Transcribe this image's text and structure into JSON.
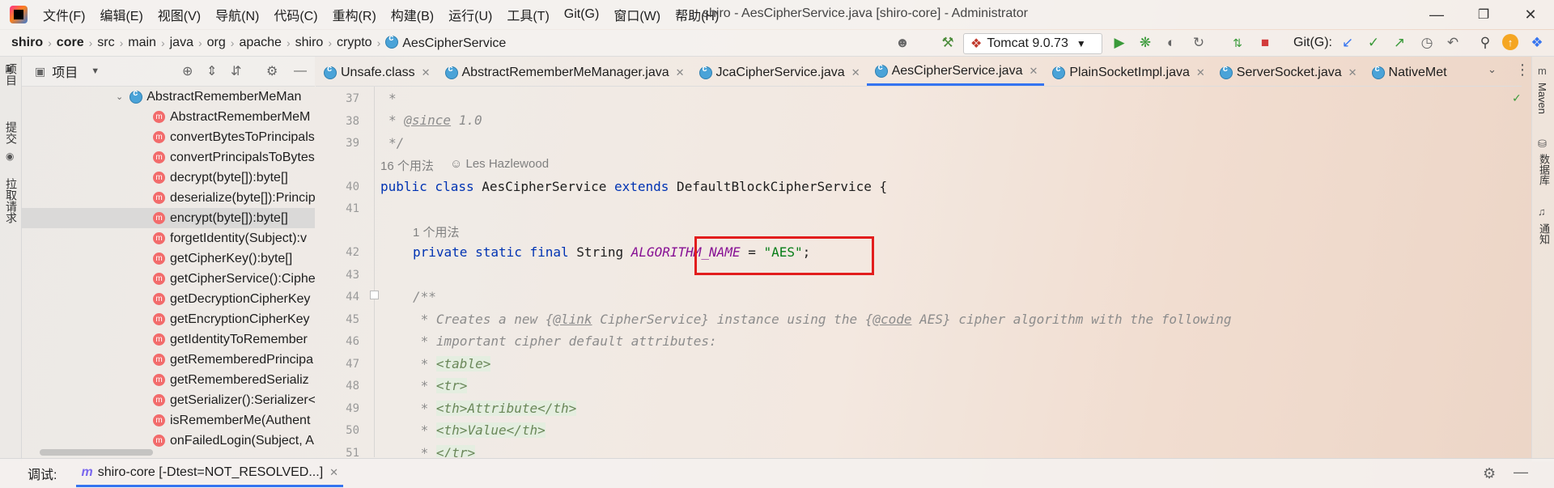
{
  "menubar": {
    "items": [
      "文件(F)",
      "编辑(E)",
      "视图(V)",
      "导航(N)",
      "代码(C)",
      "重构(R)",
      "构建(B)",
      "运行(U)",
      "工具(T)",
      "Git(G)",
      "窗口(W)",
      "帮助(H)"
    ],
    "window_title": "shiro - AesCipherService.java [shiro-core] - Administrator"
  },
  "breadcrumb": [
    "shiro",
    "core",
    "src",
    "main",
    "java",
    "org",
    "apache",
    "shiro",
    "crypto",
    "AesCipherService"
  ],
  "toolbar": {
    "run_config": "Tomcat 9.0.73",
    "git_label": "Git(G):"
  },
  "left_strip": {
    "project": "项目",
    "commit": "提交",
    "pull_requests": "拉取请求"
  },
  "project_panel": {
    "title": "项目",
    "tree": [
      {
        "label": "AbstractRememberMeMan",
        "kind": "class"
      },
      {
        "label": "AbstractRememberMeM",
        "kind": "method"
      },
      {
        "label": "convertBytesToPrincipals",
        "kind": "method"
      },
      {
        "label": "convertPrincipalsToBytes",
        "kind": "method"
      },
      {
        "label": "decrypt(byte[]):byte[]",
        "kind": "method"
      },
      {
        "label": "deserialize(byte[]):Princip",
        "kind": "method"
      },
      {
        "label": "encrypt(byte[]):byte[]",
        "kind": "method"
      },
      {
        "label": "forgetIdentity(Subject):v",
        "kind": "method"
      },
      {
        "label": "getCipherKey():byte[]",
        "kind": "method"
      },
      {
        "label": "getCipherService():Ciphe",
        "kind": "method"
      },
      {
        "label": "getDecryptionCipherKey",
        "kind": "method"
      },
      {
        "label": "getEncryptionCipherKey",
        "kind": "method"
      },
      {
        "label": "getIdentityToRemember",
        "kind": "method"
      },
      {
        "label": "getRememberedPrincipa",
        "kind": "method"
      },
      {
        "label": "getRememberedSerializ",
        "kind": "method"
      },
      {
        "label": "getSerializer():Serializer<",
        "kind": "method"
      },
      {
        "label": "isRememberMe(Authent",
        "kind": "method"
      },
      {
        "label": "onFailedLogin(Subject, A",
        "kind": "method"
      }
    ],
    "selected_item": "encrypt(byte[]):byte[]"
  },
  "editor_tabs": [
    {
      "label": "Unsafe.class",
      "active": false
    },
    {
      "label": "AbstractRememberMeManager.java",
      "active": false
    },
    {
      "label": "JcaCipherService.java",
      "active": false
    },
    {
      "label": "AesCipherService.java",
      "active": true
    },
    {
      "label": "PlainSocketImpl.java",
      "active": false
    },
    {
      "label": "ServerSocket.java",
      "active": false
    },
    {
      "label": "NativeMet",
      "active": false
    }
  ],
  "editor": {
    "line_numbers": [
      "37",
      "38",
      "39",
      "40",
      "41",
      "42",
      "43",
      "44",
      "45",
      "46",
      "47",
      "48",
      "49",
      "50",
      "51"
    ],
    "line37": "*",
    "line38_star": "* ",
    "line38_tag": "@since",
    "line38_rest": " 1.0",
    "line39": "*/",
    "usage_hint_class": "16 个用法",
    "author_hint": "Les Hazlewood",
    "line40_kw1": "public class",
    "line40_name": " AesCipherService ",
    "line40_kw2": "extends",
    "line40_rest": " DefaultBlockCipherService {",
    "usage_hint_field": "1 个用法",
    "line42_kw": "private static final",
    "line42_type": " String ",
    "line42_field": "ALGORITHM_NAME",
    "line42_eq": " = ",
    "line42_str": "\"AES\"",
    "line42_end": ";",
    "line44": "/**",
    "line45_a": " * Creates a new {",
    "line45_link": "@link",
    "line45_b": " CipherService} instance using the {",
    "line45_code": "@code",
    "line45_c": " AES} cipher algorithm with the following",
    "line46": " * important cipher default attributes:",
    "line47_star": " * ",
    "line47_tag": "<table>",
    "line48_star": " * ",
    "line48_tag": "<tr>",
    "line49_star": " * ",
    "line49_tag": "<th>",
    "line49_text": "Attribute",
    "line49_end": "</th>",
    "line50_star": " * ",
    "line50_tag": "<th>",
    "line50_text": "Value",
    "line50_end": "</th>",
    "line51_star": " * ",
    "line51_tag": "</tr>"
  },
  "right_strip": {
    "maven": "Maven",
    "database": "数据库",
    "notifications": "通知"
  },
  "bottom": {
    "debug_label": "调试:",
    "session": "shiro-core [-Dtest=NOT_RESOLVED...]"
  },
  "colors": {
    "keyword": "#0033b3",
    "field": "#871094",
    "string": "#067d17",
    "comment": "#8c8c8c",
    "highlight_box": "#e21d1d",
    "active_tab": "#3574f0"
  }
}
